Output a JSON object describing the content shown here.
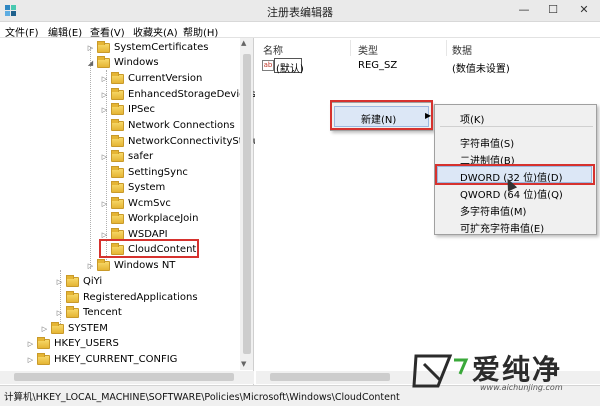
{
  "window": {
    "title": "注册表编辑器",
    "min_glyph": "—",
    "max_glyph": "☐",
    "close_glyph": "✕"
  },
  "menubar": [
    {
      "label": "文件(F)"
    },
    {
      "label": "编辑(E)"
    },
    {
      "label": "查看(V)"
    },
    {
      "label": "收藏夹(A)"
    },
    {
      "label": "帮助(H)"
    }
  ],
  "tree": {
    "nodes": [
      {
        "label": "SystemCertificates",
        "arrow": "▷"
      },
      {
        "label": "Windows",
        "arrow": "◢"
      },
      {
        "label": "CurrentVersion",
        "arrow": "▷"
      },
      {
        "label": "EnhancedStorageDevices",
        "arrow": "▷"
      },
      {
        "label": "IPSec",
        "arrow": "▷"
      },
      {
        "label": "Network Connections",
        "arrow": ""
      },
      {
        "label": "NetworkConnectivityStatu",
        "arrow": ""
      },
      {
        "label": "safer",
        "arrow": "▷"
      },
      {
        "label": "SettingSync",
        "arrow": ""
      },
      {
        "label": "System",
        "arrow": ""
      },
      {
        "label": "WcmSvc",
        "arrow": "▷"
      },
      {
        "label": "WorkplaceJoin",
        "arrow": ""
      },
      {
        "label": "WSDAPI",
        "arrow": "▷"
      },
      {
        "label": "CloudContent",
        "arrow": ""
      },
      {
        "label": "Windows NT",
        "arrow": "▷"
      },
      {
        "label": "QiYi",
        "arrow": "▷"
      },
      {
        "label": "RegisteredApplications",
        "arrow": ""
      },
      {
        "label": "Tencent",
        "arrow": "▷"
      },
      {
        "label": "SYSTEM",
        "arrow": "▷"
      },
      {
        "label": "HKEY_USERS",
        "arrow": "▷"
      },
      {
        "label": "HKEY_CURRENT_CONFIG",
        "arrow": "▷"
      }
    ]
  },
  "list": {
    "headers": {
      "name": "名称",
      "type": "类型",
      "data": "数据"
    },
    "rows": [
      {
        "icon": "ab",
        "name": "(默认)",
        "type": "REG_SZ",
        "data": "(数值未设置)"
      }
    ]
  },
  "context_menu": {
    "new_label": "新建(N)",
    "arrow": "▶"
  },
  "submenu": [
    {
      "label": "项(K)"
    },
    {
      "label": "字符串值(S)"
    },
    {
      "label": "二进制值(B)"
    },
    {
      "label": "DWORD (32 位)值(D)"
    },
    {
      "label": "QWORD (64 位)值(Q)"
    },
    {
      "label": "多字符串值(M)"
    },
    {
      "label": "可扩充字符串值(E)"
    }
  ],
  "status_path": "计算机\\HKEY_LOCAL_MACHINE\\SOFTWARE\\Policies\\Microsoft\\Windows\\CloudContent",
  "watermark": {
    "brand": "爱纯净",
    "url": "www.aichunjing.com"
  },
  "colors": {
    "highlight_red": "#d6322e",
    "menu_hover": "#dce7f6",
    "folder": "#e5b534"
  }
}
